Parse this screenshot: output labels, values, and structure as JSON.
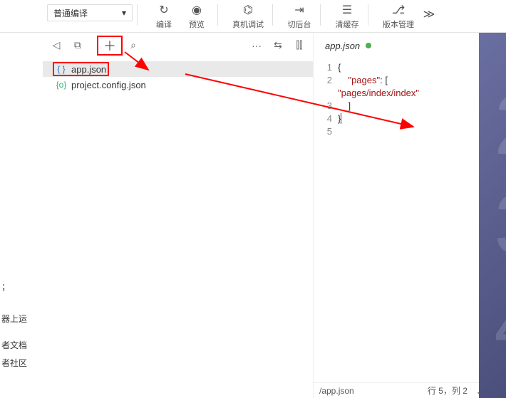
{
  "toolbar": {
    "compile_mode": "普通编译",
    "compile": "编译",
    "preview": "预览",
    "remote_debug": "真机调试",
    "background": "切后台",
    "clear_cache": "清缓存",
    "version_control": "版本管理"
  },
  "filetree": {
    "items": [
      {
        "icon": "{ }",
        "name": "app.json",
        "selected": true
      },
      {
        "icon": "{o}",
        "name": "project.config.json",
        "selected": false
      }
    ]
  },
  "editor": {
    "tab_name": "app.json",
    "modified": true,
    "lines": {
      "1": "{",
      "2i": "    ",
      "2s": "\"pages\"",
      "2r": ": [",
      "3": "",
      "3s": "\"pages/index/index\"",
      "4": "    ]",
      "5": "}"
    }
  },
  "status": {
    "path": "/app.json",
    "position": "行 5，列 2",
    "lang": "JSON"
  },
  "side_text": {
    "a": "；",
    "b": "器上运",
    "c": "者文档",
    "d": "者社区"
  },
  "glyphs": {
    "dropdown": "▾",
    "refresh": "↻",
    "eye": "◉",
    "bug": "⌬",
    "background_icon": "⇥",
    "stack": "☰",
    "vcs": "⎇",
    "overflow": "≫",
    "speaker": "◁",
    "split": "⧉",
    "plus": "＋",
    "search": "⌕",
    "more": "···",
    "indent": "⇆",
    "columns": "⫿⫿"
  }
}
